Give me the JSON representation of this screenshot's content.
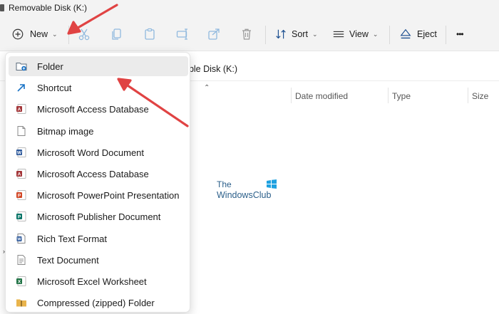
{
  "window": {
    "title": "Removable Disk (K:)"
  },
  "toolbar": {
    "new_label": "New",
    "sort_label": "Sort",
    "view_label": "View",
    "eject_label": "Eject",
    "more_label": "•••"
  },
  "address": {
    "text": "able Disk (K:)"
  },
  "columns": {
    "date_modified": "Date modified",
    "type": "Type",
    "size": "Size"
  },
  "watermark": {
    "line1": "The",
    "line2": "WindowsClub"
  },
  "new_menu": {
    "items": [
      {
        "label": "Folder",
        "icon": "folder-new-icon",
        "color": "#e9b44c"
      },
      {
        "label": "Shortcut",
        "icon": "shortcut-icon",
        "color": "#1a73c6"
      },
      {
        "label": "Microsoft Access Database",
        "icon": "access-icon",
        "color": "#a4373a"
      },
      {
        "label": "Bitmap image",
        "icon": "bitmap-icon",
        "color": "#5b6b7b"
      },
      {
        "label": "Microsoft Word Document",
        "icon": "word-icon",
        "color": "#2b579a"
      },
      {
        "label": "Microsoft Access Database",
        "icon": "access-icon",
        "color": "#a4373a"
      },
      {
        "label": "Microsoft PowerPoint Presentation",
        "icon": "powerpoint-icon",
        "color": "#d24726"
      },
      {
        "label": "Microsoft Publisher Document",
        "icon": "publisher-icon",
        "color": "#077568"
      },
      {
        "label": "Rich Text Format",
        "icon": "rtf-icon",
        "color": "#2b579a"
      },
      {
        "label": "Text Document",
        "icon": "text-document-icon",
        "color": "#8a8a8a"
      },
      {
        "label": "Microsoft Excel Worksheet",
        "icon": "excel-icon",
        "color": "#217346"
      },
      {
        "label": "Compressed (zipped) Folder",
        "icon": "zip-folder-icon",
        "color": "#e9b44c"
      }
    ]
  },
  "colors": {
    "toolbar_bg": "#f3f3f3",
    "arrow": "#e04343",
    "accent": "#1a73c6"
  }
}
